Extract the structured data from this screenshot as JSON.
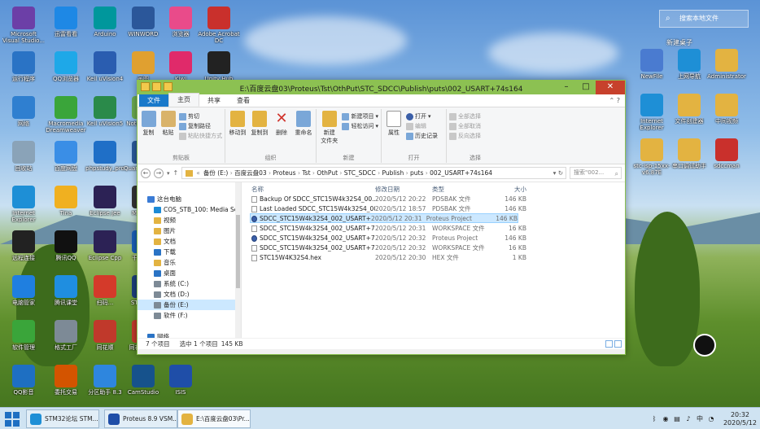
{
  "desktop_icons": [
    {
      "label": "Microsoft Visual Studio...",
      "color": "#6c3fa7"
    },
    {
      "label": "迅雷看看",
      "color": "#1e88e5"
    },
    {
      "label": "Arduino",
      "color": "#00979c"
    },
    {
      "label": "WINWORD",
      "color": "#2b579a"
    },
    {
      "label": "浏览器",
      "color": "#e94b8a"
    },
    {
      "label": "Adobe Acrobat DC",
      "color": "#c9302c"
    },
    {
      "label": "运行程序",
      "color": "#2a73c5"
    },
    {
      "label": "QQ浏览器",
      "color": "#1ea8e8"
    },
    {
      "label": "Keil uVision4",
      "color": "#2a5db0"
    },
    {
      "label": "画图",
      "color": "#e0a030"
    },
    {
      "label": "Kiwi",
      "color": "#e02a6a"
    },
    {
      "label": "Unity Hub",
      "color": "#222222"
    },
    {
      "label": "网络",
      "color": "#2f7fd0"
    },
    {
      "label": "Macromedia Dreamweaver",
      "color": "#3aa53a"
    },
    {
      "label": "Keil uVision5",
      "color": "#2a8a4a"
    },
    {
      "label": "Notepad++",
      "color": "#6aa84f"
    },
    {
      "label": "回收站",
      "color": "#8aa3b8"
    },
    {
      "label": "百度网盘",
      "color": "#3a8ee6"
    },
    {
      "label": "phpstudy_pro",
      "color": "#1f6fc7"
    },
    {
      "label": "Quartus II 32-bit",
      "color": "#2a5a9a"
    },
    {
      "label": "Internet Explorer",
      "color": "#1e8fd6"
    },
    {
      "label": "Tina",
      "color": "#f0b020"
    },
    {
      "label": "Eclipse Jee",
      "color": "#2c2255"
    },
    {
      "label": "Model...",
      "color": "#333333"
    },
    {
      "label": "远程连接",
      "color": "#222222"
    },
    {
      "label": "腾讯QQ",
      "color": "#111111"
    },
    {
      "label": "Eclipse Cpp",
      "color": "#2c2255"
    },
    {
      "label": "千牛工...",
      "color": "#1a5fb4"
    },
    {
      "label": "电脑管家",
      "color": "#1f7fe0"
    },
    {
      "label": "腾讯课堂",
      "color": "#1f8ee0"
    },
    {
      "label": "扫码...",
      "color": "#d43a2a"
    },
    {
      "label": "STM32...",
      "color": "#1c3f7a"
    },
    {
      "label": "软件管理",
      "color": "#3aa53a"
    },
    {
      "label": "格式工厂",
      "color": "#7d8a96"
    },
    {
      "label": "同花顺",
      "color": "#c0392b"
    },
    {
      "label": "同花顺有...",
      "color": "#c0392b"
    },
    {
      "label": "QQ影音",
      "color": "#1e6fc2"
    },
    {
      "label": "委托交易",
      "color": "#d35400"
    },
    {
      "label": "分区助手 8.3",
      "color": "#2e86de"
    },
    {
      "label": "CamStudio",
      "color": "#16528c"
    },
    {
      "label": "ISIS",
      "color": "#1f4ea8"
    }
  ],
  "right_icons": [
    {
      "label": "NewFile",
      "color": "#4a7bd0"
    },
    {
      "label": "上网导航",
      "color": "#1e8fd6"
    },
    {
      "label": "Administrator",
      "color": "#e3b341"
    },
    {
      "label": "Internet Explorer",
      "color": "#1e8fd6"
    },
    {
      "label": "文件创建器",
      "color": "#e3b341"
    },
    {
      "label": "中间视频",
      "color": "#e3b341"
    },
    {
      "label": "stc-isp-15xx-v6.87E",
      "color": "#e3b341"
    },
    {
      "label": "串口调试助手",
      "color": "#e3b341"
    },
    {
      "label": "sdccman",
      "color": "#c9302c"
    }
  ],
  "right_panel": {
    "search_placeholder": "搜索本地文件",
    "group_label": "新建桌子"
  },
  "window": {
    "title": "E:\\百度云盘03\\Proteus\\Tst\\OthPut\\STC_SDCC\\Publish\\puts\\002_USART+74s164",
    "ribbon_tabs": [
      "文件",
      "主页",
      "共享",
      "查看"
    ],
    "ribbon": {
      "clipboard": {
        "copy": "复制",
        "paste": "粘贴",
        "cut": "剪切",
        "copy_path": "复制路径",
        "paste_shortcut": "粘贴快捷方式",
        "name": "剪贴板"
      },
      "organize": {
        "move_to": "移动到",
        "copy_to": "复制到",
        "delete": "删除",
        "rename": "重命名",
        "name": "组织"
      },
      "new": {
        "new_folder": "新建\n文件夹",
        "new_item": "新建项目",
        "easy_access": "轻松访问",
        "name": "新建"
      },
      "open": {
        "properties": "属性",
        "open": "打开",
        "edit": "编辑",
        "history": "历史记录",
        "name": "打开"
      },
      "select": {
        "select_all": "全部选择",
        "select_none": "全部取消",
        "invert": "反向选择",
        "name": "选择"
      }
    },
    "address": [
      "备份 (E:)",
      "百度云盘03",
      "Proteus",
      "Tst",
      "OthPut",
      "STC_SDCC",
      "Publish",
      "puts",
      "002_USART+74s164"
    ],
    "search_placeholder": "搜索\"002...",
    "nav": [
      {
        "label": "这台电脑",
        "color": "#3a7bd5"
      },
      {
        "label": "COS_STB_100: Media Serv",
        "color": "#1c8ad6"
      },
      {
        "label": "视频",
        "color": "#e3b341"
      },
      {
        "label": "图片",
        "color": "#e3b341"
      },
      {
        "label": "文档",
        "color": "#e3b341"
      },
      {
        "label": "下载",
        "color": "#2a73c5"
      },
      {
        "label": "音乐",
        "color": "#e3b341"
      },
      {
        "label": "桌面",
        "color": "#2a73c5"
      },
      {
        "label": "系统 (C:)",
        "color": "#7d8a96"
      },
      {
        "label": "文档 (D:)",
        "color": "#7d8a96"
      },
      {
        "label": "备份 (E:)",
        "color": "#7d8a96"
      },
      {
        "label": "软件 (F:)",
        "color": "#7d8a96"
      },
      {
        "label": "",
        "color": "transparent"
      },
      {
        "label": "网络",
        "color": "#2a73c5"
      }
    ],
    "columns": {
      "name": "名称",
      "date": "修改日期",
      "type": "类型",
      "size": "大小"
    },
    "files": [
      {
        "name": "Backup Of SDCC_STC15W4k32S4_00...",
        "date": "2020/5/12 20:22",
        "type": "PDSBAK 文件",
        "size": "146 KB",
        "proj": false
      },
      {
        "name": "Last Loaded SDCC_STC15W4k32S4_00...",
        "date": "2020/5/12 18:57",
        "type": "PDSBAK 文件",
        "size": "146 KB",
        "proj": false
      },
      {
        "name": "SDCC_STC15W4k32S4_002_USART+7...",
        "date": "2020/5/12 20:31",
        "type": "Proteus Project",
        "size": "146 KB",
        "proj": true
      },
      {
        "name": "SDCC_STC15W4k32S4_002_USART+7...",
        "date": "2020/5/12 20:31",
        "type": "WORKSPACE 文件",
        "size": "16 KB",
        "proj": false
      },
      {
        "name": "SDCC_STC15W4k32S4_002_USART+7...",
        "date": "2020/5/12 20:32",
        "type": "Proteus Project",
        "size": "146 KB",
        "proj": true
      },
      {
        "name": "SDCC_STC15W4k32S4_002_USART+7...",
        "date": "2020/5/12 20:32",
        "type": "WORKSPACE 文件",
        "size": "16 KB",
        "proj": false
      },
      {
        "name": "STC15W4K32S4.hex",
        "date": "2020/5/12 20:30",
        "type": "HEX 文件",
        "size": "1 KB",
        "proj": false
      }
    ],
    "status": {
      "count": "7 个项目",
      "selected": "选中 1 个项目",
      "size": "145 KB"
    }
  },
  "taskbar": {
    "buttons": [
      {
        "label": "STM32论坛 STM...",
        "color": "#1e8fd6"
      },
      {
        "label": "Proteus 8.9 VSM...",
        "color": "#1f4ea8"
      },
      {
        "label": "E:\\百度云盘03\\Pr...",
        "color": "#e3b341"
      }
    ],
    "time": "20:32",
    "date": "2020/5/12"
  }
}
